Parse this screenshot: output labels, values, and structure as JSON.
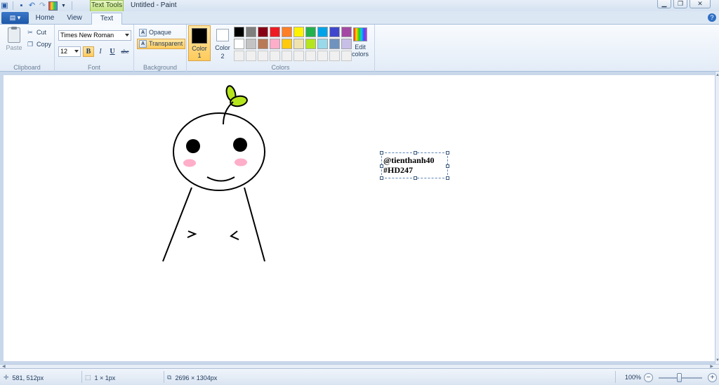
{
  "window": {
    "title": "Untitled - Paint",
    "context_tab": "Text Tools",
    "controls": [
      "minimize",
      "restore",
      "close"
    ]
  },
  "quick_access": [
    "paint-menu-icon",
    "save-icon",
    "undo-icon",
    "redo-icon",
    "colors-icon",
    "customize-icon"
  ],
  "tabs": [
    {
      "label": "Home",
      "active": false
    },
    {
      "label": "View",
      "active": false
    },
    {
      "label": "Text",
      "active": true
    }
  ],
  "ribbon": {
    "clipboard": {
      "caption": "Clipboard",
      "paste": "Paste",
      "cut": "Cut",
      "copy": "Copy"
    },
    "font": {
      "caption": "Font",
      "family": "Times New Roman",
      "size": "12",
      "bold": "B",
      "italic": "I",
      "underline": "U",
      "strike": "abc",
      "bold_active": true
    },
    "background": {
      "caption": "Background",
      "opaque": "Opaque",
      "transparent": "Transparent",
      "selected": "Transparent"
    },
    "colors": {
      "caption": "Colors",
      "color1_label": "Color\n1",
      "color1_l1": "Color",
      "color1_l2": "1",
      "color2_l1": "Color",
      "color2_l2": "2",
      "color1": "#000000",
      "color2": "#ffffff",
      "edit_l1": "Edit",
      "edit_l2": "colors",
      "palette_row1": [
        "#000000",
        "#7f7f7f",
        "#880015",
        "#ed1c24",
        "#ff7f27",
        "#fff200",
        "#22b14c",
        "#00a2e8",
        "#3f48cc",
        "#a349a4"
      ],
      "palette_row2": [
        "#ffffff",
        "#c3c3c3",
        "#b97a57",
        "#ffaec9",
        "#ffc90e",
        "#efe4b0",
        "#b5e61d",
        "#99d9ea",
        "#7092be",
        "#c8bfe7"
      ],
      "palette_row3": [
        "#f0f0f0",
        "#f0f0f0",
        "#f0f0f0",
        "#f0f0f0",
        "#f0f0f0",
        "#f0f0f0",
        "#f0f0f0",
        "#f0f0f0",
        "#f0f0f0",
        "#f0f0f0"
      ]
    }
  },
  "canvas": {
    "text_line1": "@tienthanh40",
    "text_line2": "#HD247"
  },
  "status": {
    "cursor": "581, 512px",
    "selection": "1 × 1px",
    "image_size": "2696 × 1304px",
    "zoom": "100%"
  }
}
